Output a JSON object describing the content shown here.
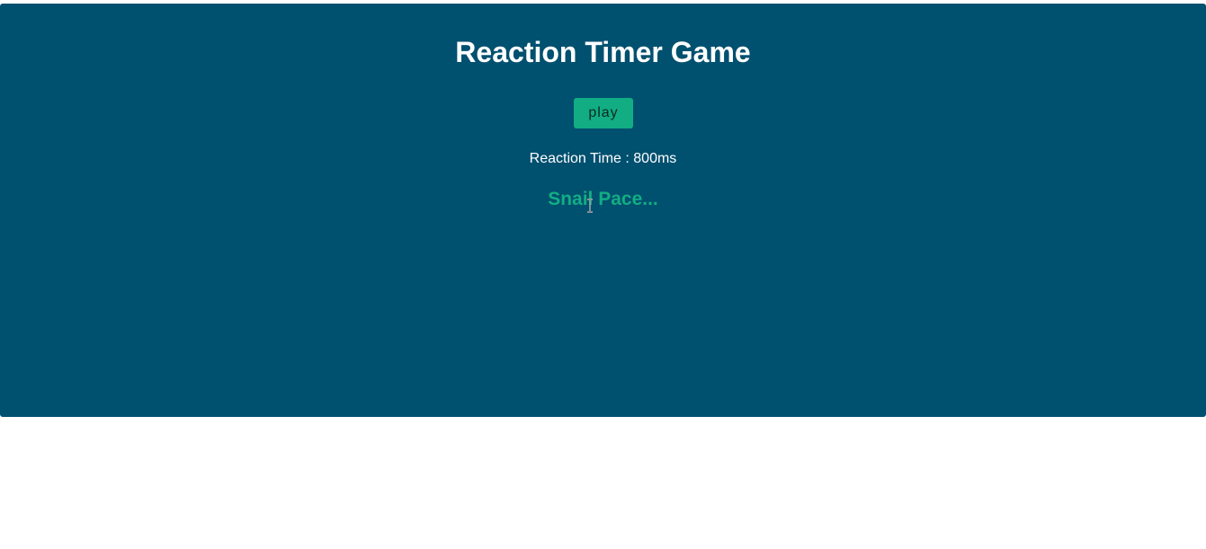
{
  "app": {
    "title": "Reaction Timer Game",
    "colors": {
      "panel_background": "#00506f",
      "accent": "#12ad83",
      "text": "#ffffff"
    }
  },
  "controls": {
    "play_label": "play"
  },
  "result": {
    "reaction_label": "Reaction Time : ",
    "reaction_value": "800ms",
    "verdict": "Snail Pace..."
  },
  "cursor": {
    "icon": "text-cursor-icon"
  }
}
